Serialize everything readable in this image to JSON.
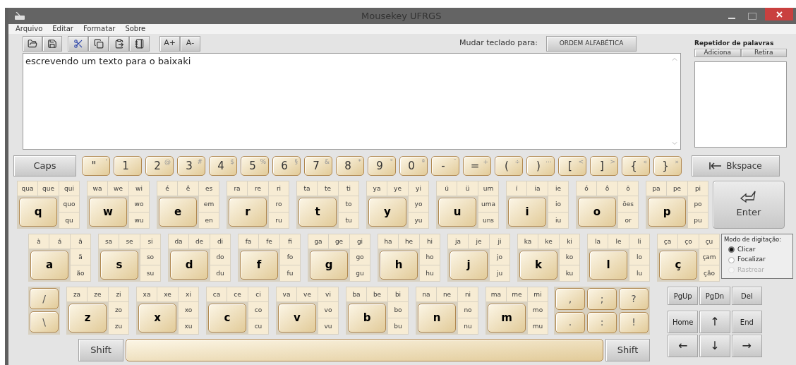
{
  "window": {
    "title": "Mousekey UFRGS"
  },
  "menu": [
    "Arquivo",
    "Editar",
    "Formatar",
    "Sobre"
  ],
  "toolbar": {
    "font_buttons": [
      "A+",
      "A-"
    ],
    "switch_label": "Mudar teclado para:",
    "switch_button": "ORDEM ALFABÉTICA"
  },
  "editor": {
    "value": "escrevendo um texto para o baixaki"
  },
  "word_repeater": {
    "title": "Repetidor de palavras",
    "buttons": [
      "Adiciona",
      "Retira"
    ]
  },
  "keyboard": {
    "caps": "Caps",
    "backspace": "Bkspace",
    "enter": "Enter",
    "number_keys": [
      {
        "main": "\"",
        "alt": "'"
      },
      {
        "main": "1"
      },
      {
        "main": "2",
        "alt": "@"
      },
      {
        "main": "3",
        "alt": "#"
      },
      {
        "main": "4",
        "alt": "$"
      },
      {
        "main": "5",
        "alt": "%"
      },
      {
        "main": "6",
        "alt": "§"
      },
      {
        "main": "7",
        "alt": "&"
      },
      {
        "main": "8",
        "alt": "*"
      },
      {
        "main": "9",
        "alt": "°"
      },
      {
        "main": "0",
        "alt": "ª"
      },
      {
        "main": "-",
        "alt": "¯"
      },
      {
        "main": "=",
        "alt": "+"
      },
      {
        "main": "(",
        "alt": "÷"
      },
      {
        "main": ")",
        "alt": "⋯"
      },
      {
        "main": "[",
        "alt": "<"
      },
      {
        "main": "]",
        "alt": ">"
      },
      {
        "main": "{",
        "alt": "«"
      },
      {
        "main": "}",
        "alt": "»"
      }
    ],
    "letter_rows": [
      [
        {
          "letter": "q",
          "top": [
            "qua",
            "que",
            "qui"
          ],
          "side": [
            "quo",
            "qu"
          ]
        },
        {
          "letter": "w",
          "top": [
            "wa",
            "we",
            "wi"
          ],
          "side": [
            "wo",
            "wu"
          ]
        },
        {
          "letter": "e",
          "top": [
            "é",
            "ê",
            "es"
          ],
          "side": [
            "em",
            "en"
          ]
        },
        {
          "letter": "r",
          "top": [
            "ra",
            "re",
            "ri"
          ],
          "side": [
            "ro",
            "ru"
          ]
        },
        {
          "letter": "t",
          "top": [
            "ta",
            "te",
            "ti"
          ],
          "side": [
            "to",
            "tu"
          ]
        },
        {
          "letter": "y",
          "top": [
            "ya",
            "ye",
            "yi"
          ],
          "side": [
            "yo",
            "yu"
          ]
        },
        {
          "letter": "u",
          "top": [
            "ú",
            "ü",
            "um"
          ],
          "side": [
            "uma",
            "uns"
          ]
        },
        {
          "letter": "i",
          "top": [
            "í",
            "ia",
            "ie"
          ],
          "side": [
            "io",
            "iu"
          ]
        },
        {
          "letter": "o",
          "top": [
            "ó",
            "ô",
            "õ"
          ],
          "side": [
            "ões",
            "or"
          ]
        },
        {
          "letter": "p",
          "top": [
            "pa",
            "pe",
            "pi"
          ],
          "side": [
            "po",
            "pu"
          ]
        }
      ],
      [
        {
          "letter": "a",
          "top": [
            "à",
            "á",
            "â"
          ],
          "side": [
            "ã",
            "ão"
          ]
        },
        {
          "letter": "s",
          "top": [
            "sa",
            "se",
            "si"
          ],
          "side": [
            "so",
            "su"
          ]
        },
        {
          "letter": "d",
          "top": [
            "da",
            "de",
            "di"
          ],
          "side": [
            "do",
            "du"
          ]
        },
        {
          "letter": "f",
          "top": [
            "fa",
            "fe",
            "fi"
          ],
          "side": [
            "fo",
            "fu"
          ]
        },
        {
          "letter": "g",
          "top": [
            "ga",
            "ge",
            "gi"
          ],
          "side": [
            "go",
            "gu"
          ]
        },
        {
          "letter": "h",
          "top": [
            "ha",
            "he",
            "hi"
          ],
          "side": [
            "ho",
            "hu"
          ]
        },
        {
          "letter": "j",
          "top": [
            "ja",
            "je",
            "ji"
          ],
          "side": [
            "jo",
            "ju"
          ]
        },
        {
          "letter": "k",
          "top": [
            "ka",
            "ke",
            "ki"
          ],
          "side": [
            "ko",
            "ku"
          ]
        },
        {
          "letter": "l",
          "top": [
            "la",
            "le",
            "li"
          ],
          "side": [
            "lo",
            "lu"
          ]
        },
        {
          "letter": "ç",
          "top": [
            "ça",
            "ço",
            "çu"
          ],
          "side": [
            "çam",
            "ção"
          ]
        }
      ],
      [
        {
          "letter": "z",
          "top": [
            "za",
            "ze",
            "zi"
          ],
          "side": [
            "zo",
            "zu"
          ]
        },
        {
          "letter": "x",
          "top": [
            "xa",
            "xe",
            "xi"
          ],
          "side": [
            "xo",
            "xu"
          ]
        },
        {
          "letter": "c",
          "top": [
            "ca",
            "ce",
            "ci"
          ],
          "side": [
            "co",
            "cu"
          ]
        },
        {
          "letter": "v",
          "top": [
            "va",
            "ve",
            "vi"
          ],
          "side": [
            "vo",
            "vu"
          ]
        },
        {
          "letter": "b",
          "top": [
            "ba",
            "be",
            "bi"
          ],
          "side": [
            "bo",
            "bu"
          ]
        },
        {
          "letter": "n",
          "top": [
            "na",
            "ne",
            "ni"
          ],
          "side": [
            "no",
            "nu"
          ]
        },
        {
          "letter": "m",
          "top": [
            "ma",
            "me",
            "mi"
          ],
          "side": [
            "mo",
            "mu"
          ]
        }
      ]
    ],
    "slash_keys": [
      "/",
      "\\"
    ],
    "punctuation_keys": [
      ",",
      ";",
      "?",
      ".",
      ":",
      "!"
    ],
    "shift_keys": [
      "Shift",
      "Shift"
    ],
    "nav_keys": [
      "PgUp",
      "PgDn",
      "Del",
      "Home",
      "↑",
      "End",
      "←",
      "↓",
      "→"
    ]
  },
  "typing_mode": {
    "title": "Modo de digitação:",
    "options": [
      {
        "label": "Clicar",
        "selected": true,
        "disabled": false
      },
      {
        "label": "Focalizar",
        "selected": false,
        "disabled": false
      },
      {
        "label": "Rastrear",
        "selected": false,
        "disabled": true
      }
    ]
  }
}
